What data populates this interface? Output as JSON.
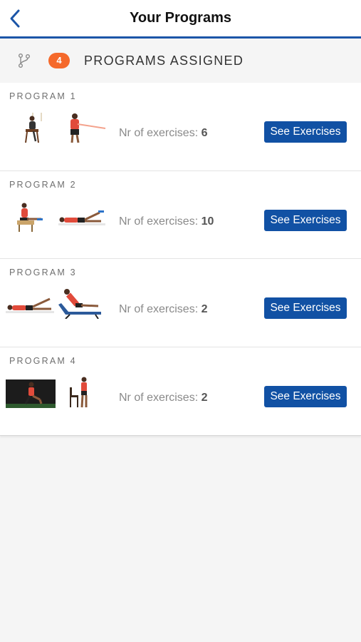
{
  "header": {
    "title": "Your Programs",
    "back_icon": "chevron-left-icon",
    "accent_color": "#1c56a8"
  },
  "summary": {
    "icon": "branch-icon",
    "count": "4",
    "label": "PROGRAMS ASSIGNED",
    "badge_color": "#f5692b"
  },
  "programs": [
    {
      "label": "PROGRAM 1",
      "count_label": "Nr of exercises:",
      "count": "6",
      "button": "See Exercises"
    },
    {
      "label": "PROGRAM 2",
      "count_label": "Nr of exercises:",
      "count": "10",
      "button": "See Exercises"
    },
    {
      "label": "PROGRAM 3",
      "count_label": "Nr of exercises:",
      "count": "2",
      "button": "See Exercises"
    },
    {
      "label": "PROGRAM 4",
      "count_label": "Nr of exercises:",
      "count": "2",
      "button": "See Exercises"
    }
  ],
  "button_color": "#1151a4"
}
